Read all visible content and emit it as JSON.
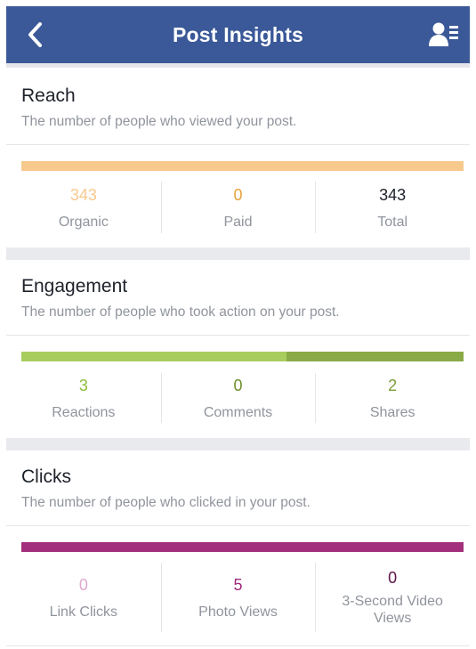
{
  "header": {
    "title": "Post Insights",
    "back_icon": "chevron-left-icon",
    "profile_icon": "person-list-icon",
    "bg_color": "#3b5998"
  },
  "sections": [
    {
      "title": "Reach",
      "description": "The number of people who viewed your post.",
      "bar": [
        {
          "fraction": 1.0,
          "color": "#f7c98d"
        }
      ],
      "stats": [
        {
          "value": "343",
          "label": "Organic",
          "color": "#f7c98d"
        },
        {
          "value": "0",
          "label": "Paid",
          "color": "#e8a23b"
        },
        {
          "value": "343",
          "label": "Total",
          "color": "#1d2129"
        }
      ]
    },
    {
      "title": "Engagement",
      "description": "The number of people who took action on your post.",
      "bar": [
        {
          "fraction": 0.6,
          "color": "#a8cd5e"
        },
        {
          "fraction": 0.4,
          "color": "#8aaa47"
        }
      ],
      "stats": [
        {
          "value": "3",
          "label": "Reactions",
          "color": "#8dbd3b"
        },
        {
          "value": "0",
          "label": "Comments",
          "color": "#6f8f2b"
        },
        {
          "value": "2",
          "label": "Shares",
          "color": "#7a9d35"
        }
      ]
    },
    {
      "title": "Clicks",
      "description": "The number of people who clicked in your post.",
      "bar": [
        {
          "fraction": 1.0,
          "color": "#a3307c"
        }
      ],
      "stats": [
        {
          "value": "0",
          "label": "Link Clicks",
          "color": "#e0a9d2"
        },
        {
          "value": "5",
          "label": "Photo Views",
          "color": "#9c2a78"
        },
        {
          "value": "0",
          "label": "3-Second Video Views",
          "color": "#5e1247"
        }
      ]
    }
  ]
}
